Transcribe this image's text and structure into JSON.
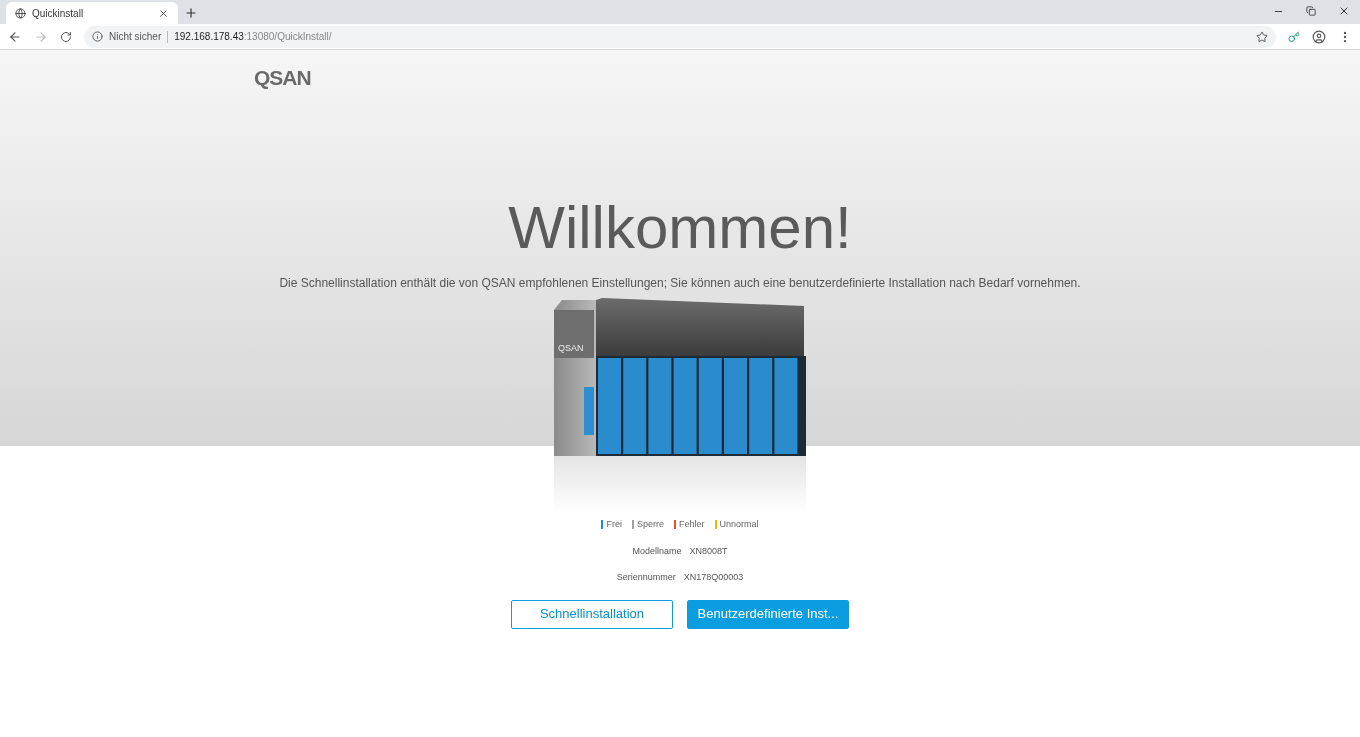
{
  "browser": {
    "tab_title": "Quickinstall",
    "security_label": "Nicht sicher",
    "url_host": "192.168.178.43",
    "url_rest": ":13080/QuickInstall/"
  },
  "logo": "QSAN",
  "heading": "Willkommen!",
  "description": "Die Schnellinstallation enthält die von QSAN empfohlenen Einstellungen; Sie können auch eine benutzerdefinierte Installation nach Bedarf vornehmen.",
  "device": {
    "label": "QSAN"
  },
  "legend": [
    {
      "label": "Frei",
      "color": "#1a8fd6"
    },
    {
      "label": "Sperre",
      "color": "#a0a0a0"
    },
    {
      "label": "Fehler",
      "color": "#e0552a"
    },
    {
      "label": "Unnormal",
      "color": "#f2b705"
    }
  ],
  "info": [
    {
      "label": "Modellname",
      "value": "XN8008T"
    },
    {
      "label": "Seriennummer",
      "value": "XN178Q00003"
    }
  ],
  "buttons": [
    {
      "label": "Schnellinstallation",
      "kind": "outline"
    },
    {
      "label": "Benutzerdefinierte Inst...",
      "kind": "primary"
    }
  ]
}
